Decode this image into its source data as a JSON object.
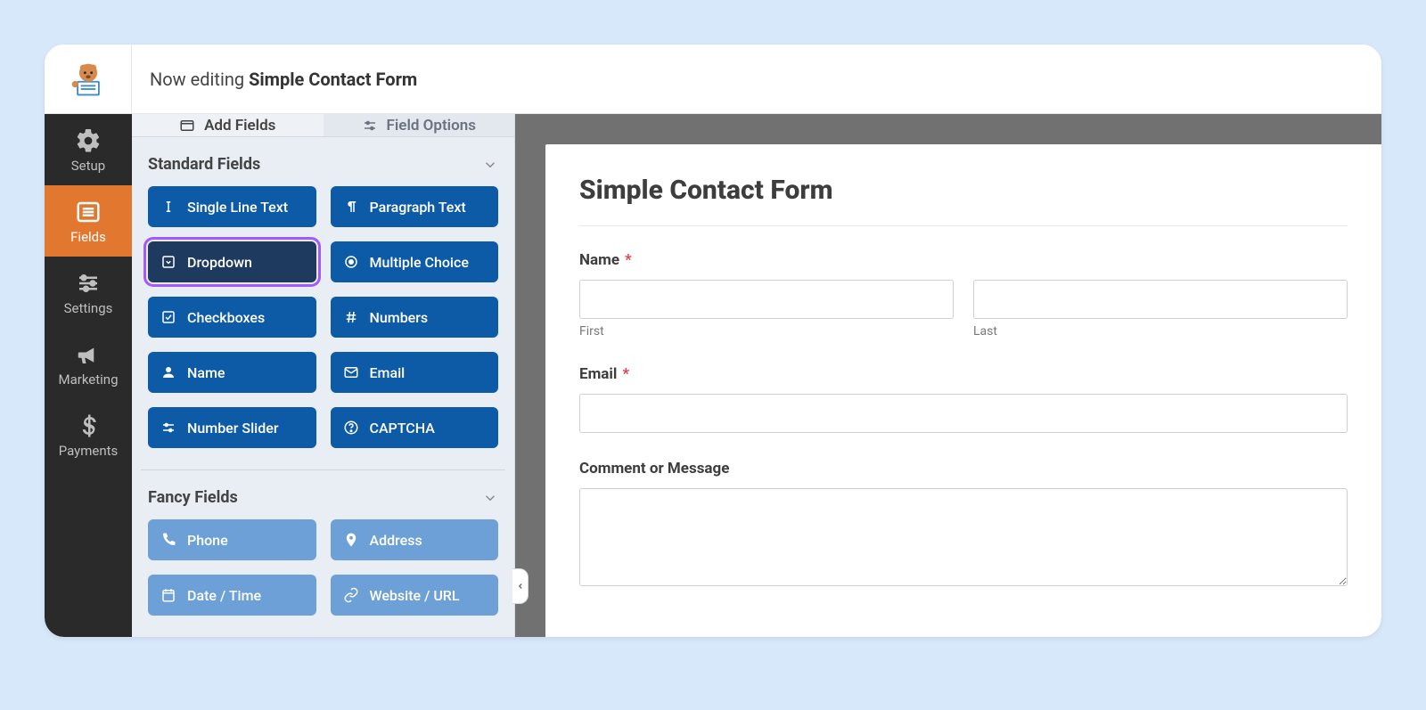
{
  "header": {
    "prefix": "Now editing ",
    "form_name": "Simple Contact Form"
  },
  "nav": {
    "setup": "Setup",
    "fields": "Fields",
    "settings": "Settings",
    "marketing": "Marketing",
    "payments": "Payments"
  },
  "tabs": {
    "add_fields": "Add Fields",
    "field_options": "Field Options"
  },
  "sections": {
    "standard": "Standard Fields",
    "fancy": "Fancy Fields"
  },
  "standard_fields": {
    "single_line_text": "Single Line Text",
    "paragraph_text": "Paragraph Text",
    "dropdown": "Dropdown",
    "multiple_choice": "Multiple Choice",
    "checkboxes": "Checkboxes",
    "numbers": "Numbers",
    "name": "Name",
    "email": "Email",
    "number_slider": "Number Slider",
    "captcha": "CAPTCHA"
  },
  "fancy_fields": {
    "phone": "Phone",
    "address": "Address",
    "date_time": "Date / Time",
    "website_url": "Website / URL"
  },
  "preview": {
    "title": "Simple Contact Form",
    "name_label": "Name",
    "first_label": "First",
    "last_label": "Last",
    "email_label": "Email",
    "comment_label": "Comment or Message",
    "required_marker": "*"
  }
}
